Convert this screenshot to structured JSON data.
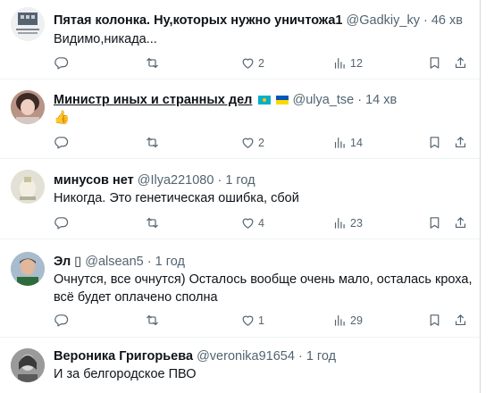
{
  "tweets": [
    {
      "name": "Пятая колонка. Ну,которых нужно уничтожа1",
      "handle": "@Gadkiy_ky",
      "time": "46 хв",
      "text": "Видимо,никада...",
      "likes": "2",
      "views": "12"
    },
    {
      "name": "Министр иных и странных дел",
      "flags": [
        "flag-kazakhstan",
        "flag-ukraine"
      ],
      "handle": "@ulya_tse",
      "time": "14 хв",
      "text": "👍",
      "likes": "2",
      "views": "14"
    },
    {
      "name": "минусов нет",
      "handle": "@Ilya221080",
      "time": "1 год",
      "text": "Никогда. Это генетическая ошибка, сбой",
      "likes": "4",
      "views": "23"
    },
    {
      "name": "Эл",
      "name_glyph": "▯",
      "handle": "@alsean5",
      "time": "1 год",
      "text": "Очнутся, все очнутся) Осталось вообще очень мало, осталась кроха, всё будет оплачено сполна",
      "likes": "1",
      "views": "29"
    },
    {
      "name": "Вероника Григорьева",
      "handle": "@veronika91654",
      "time": "1 год",
      "text": "И за белгородское ПВО"
    }
  ],
  "sep": "·",
  "colors": {
    "text": "#0f1419",
    "muted": "#536471",
    "divider": "#eff3f4",
    "kz": "#00afca",
    "ua_blue": "#0057b7",
    "ua_yellow": "#ffd700"
  }
}
